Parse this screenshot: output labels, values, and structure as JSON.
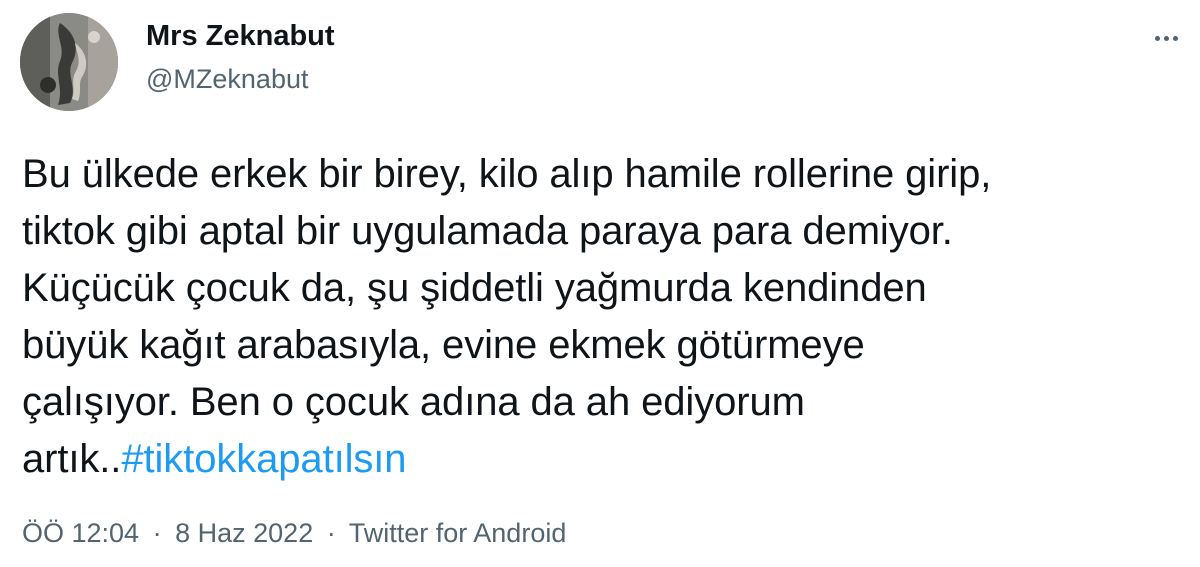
{
  "tweet": {
    "author": {
      "display_name": "Mrs Zeknabut",
      "handle": "@MZeknabut"
    },
    "more_icon": "more-horizontal-icon",
    "text_lines": [
      "Bu ülkede erkek bir birey, kilo alıp hamile rollerine girip,",
      "tiktok gibi aptal bir uygulamada paraya para demiyor.",
      "Küçücük çocuk da, şu şiddetli yağmurda kendinden",
      "büyük kağıt arabasıyla, evine ekmek götürmeye",
      "çalışıyor. Ben o çocuk adına da ah ediyorum"
    ],
    "last_line_text": "artık..",
    "hashtag": "#tiktokkapatılsın",
    "time": "ÖÖ 12:04",
    "date": "8 Haz 2022",
    "separator": "·",
    "source": "Twitter for Android",
    "colors": {
      "text": "#0f1419",
      "secondary": "#536471",
      "link": "#1d9bf0"
    }
  }
}
